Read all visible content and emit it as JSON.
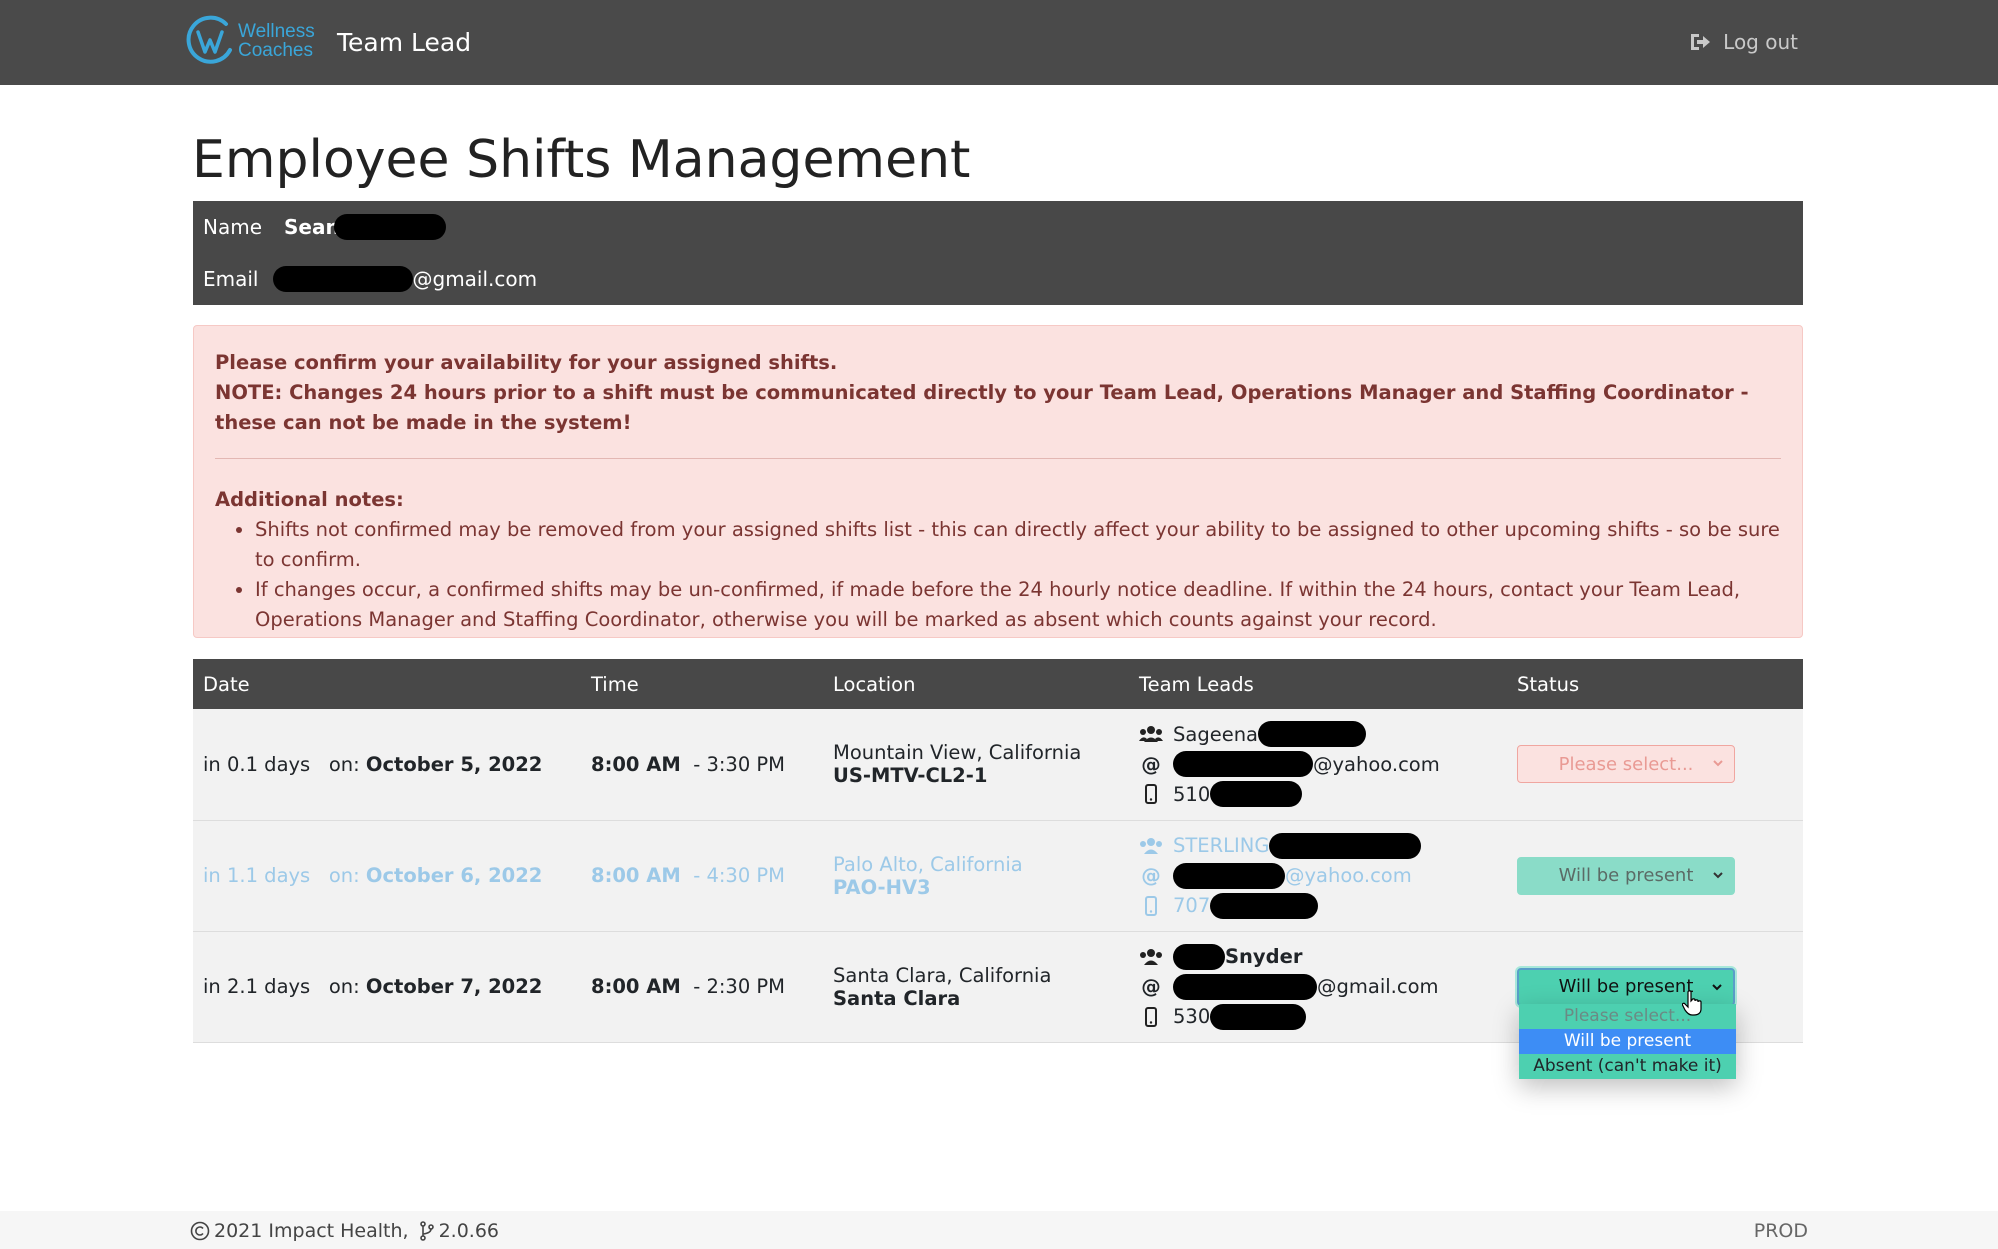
{
  "navbar": {
    "logo_line1": "Wellness",
    "logo_line2": "Coaches",
    "title": "Team Lead",
    "logout_label": "Log out"
  },
  "page": {
    "title": "Employee Shifts Management"
  },
  "user": {
    "name_label": "Name",
    "name_value": "Sean",
    "email_label": "Email",
    "email_value": "@gmail.com"
  },
  "alert": {
    "line1": "Please confirm your availability for your assigned shifts.",
    "line2": "NOTE: Changes 24 hours prior to a shift must be communicated directly to your Team Lead, Operations Manager and Staffing Coordinator - these can not be made in the system!",
    "notes_title": "Additional notes:",
    "notes": [
      "Shifts not confirmed may be removed from your assigned shifts list - this can directly affect your ability to be assigned to other upcoming shifts - so be sure to confirm.",
      "If changes occur, a confirmed shifts may be un-confirmed, if made before the 24 hourly notice deadline. If within the 24 hours, contact your Team Lead, Operations Manager and Staffing Coordinator, otherwise you will be marked as absent which counts against your record."
    ]
  },
  "table": {
    "headers": [
      "Date",
      "Time",
      "Location",
      "Team Leads",
      "Status"
    ],
    "rows": [
      {
        "relative": "in 0.1 days",
        "on": "on:",
        "date": "October 5, 2022",
        "start": "8:00 AM",
        "end": "- 3:30 PM",
        "city": "Mountain View, California",
        "site": "US-MTV-CL2-1",
        "lead_name": "Sageena",
        "lead_email": "@yahoo.com",
        "lead_phone": "510",
        "status": "Please select..."
      },
      {
        "relative": "in 1.1 days",
        "on": "on:",
        "date": "October 6, 2022",
        "start": "8:00 AM",
        "end": "- 4:30 PM",
        "city": "Palo Alto, California",
        "site": "PAO-HV3",
        "lead_name": "STERLING",
        "lead_email": "@yahoo.com",
        "lead_phone": "707",
        "status": "Will be present"
      },
      {
        "relative": "in 2.1 days",
        "on": "on:",
        "date": "October 7, 2022",
        "start": "8:00 AM",
        "end": "- 2:30 PM",
        "city": "Santa Clara, California",
        "site": "Santa Clara",
        "lead_name": "Snyder",
        "lead_email": "@gmail.com",
        "lead_phone": "530",
        "status": "Will be present"
      }
    ]
  },
  "dropdown": {
    "options": [
      "Please select...",
      "Will be present",
      "Absent (can't make it)"
    ]
  },
  "footer": {
    "copyright": "2021 Impact Health,",
    "version": "2.0.66",
    "env": "PROD"
  },
  "colors": {
    "navbar": "#4a4a4a",
    "alert_bg": "#fbe2e0",
    "status_teal": "#4dd0b0",
    "selected_option": "#3d8df5",
    "faded_row_text": "#9cc9e8"
  }
}
